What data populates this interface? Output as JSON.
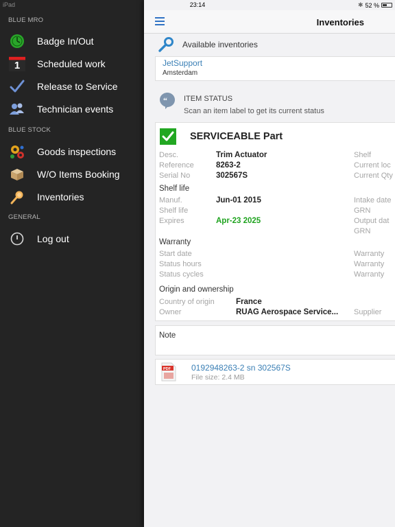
{
  "status_bar": {
    "device": "iPad",
    "time": "23:14",
    "battery": "52 %",
    "battery_level": 0.52
  },
  "sidebar": {
    "sections": [
      {
        "header": "BLUE MRO",
        "items": [
          {
            "label": "Badge In/Out",
            "icon": "clock-icon"
          },
          {
            "label": "Scheduled work",
            "icon": "calendar-icon"
          },
          {
            "label": "Release to Service",
            "icon": "checkmark-icon"
          },
          {
            "label": "Technician events",
            "icon": "people-icon"
          }
        ]
      },
      {
        "header": "BLUE STOCK",
        "items": [
          {
            "label": "Goods inspections",
            "icon": "gears-icon"
          },
          {
            "label": "W/O Items Booking",
            "icon": "box-icon"
          },
          {
            "label": "Inventories",
            "icon": "magnifier-icon"
          }
        ]
      },
      {
        "header": "GENERAL",
        "items": [
          {
            "label": "Log out",
            "icon": "power-icon"
          }
        ]
      }
    ],
    "calendar_day": "1"
  },
  "navbar": {
    "title": "Inventories"
  },
  "inventories": {
    "header": "Available inventories",
    "selected": {
      "name": "JetSupport",
      "location": "Amsterdam"
    }
  },
  "item_status": {
    "header": "ITEM STATUS",
    "hint": "Scan an item label to get its current status",
    "state": "SERVICEABLE Part",
    "state_color": "#22a722",
    "labels": {
      "desc": "Desc.",
      "reference": "Reference",
      "serial": "Serial No",
      "shelf": "Shelf",
      "current_loc": "Current loc",
      "current_qty": "Current Qty",
      "manuf": "Manuf.",
      "shelf_life": "Shelf life",
      "expires": "Expires",
      "intake_date": "Intake date",
      "grn": "GRN",
      "output_date": "Output dat",
      "grn2": "GRN",
      "start_date": "Start date",
      "status_hours": "Status hours",
      "status_cycles": "Status cycles",
      "warranty1": "Warranty",
      "warranty2": "Warranty",
      "warranty3": "Warranty",
      "country_origin": "Country of origin",
      "owner": "Owner",
      "supplier": "Supplier"
    },
    "values": {
      "desc": "Trim Actuator",
      "reference": "8263-2",
      "serial": "302567S",
      "manuf": "Jun-01 2015",
      "expires": "Apr-23 2025",
      "country_origin": "France",
      "owner": "RUAG Aerospace Service..."
    },
    "subheaders": {
      "shelf_life": "Shelf life",
      "warranty": "Warranty",
      "origin": "Origin and ownership"
    }
  },
  "note": {
    "label": "Note"
  },
  "attachment": {
    "filename": "0192948263-2 sn 302567S",
    "size": "File size: 2.4 MB",
    "type_label": "PDF"
  }
}
